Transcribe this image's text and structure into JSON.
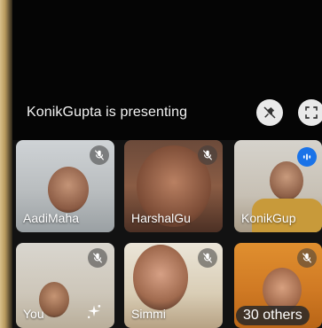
{
  "banner": {
    "presenting_text": "KonikGupta is presenting"
  },
  "controls": {
    "pin_icon": "unpin-icon",
    "fullscreen_icon": "fullscreen-icon"
  },
  "participants": [
    {
      "name": "AadiMaha",
      "muted": true
    },
    {
      "name": "HarshalGu",
      "muted": true
    },
    {
      "name": "KonikGup",
      "muted": false,
      "speaking": true
    },
    {
      "name": "You",
      "muted": true
    },
    {
      "name": "Simmi",
      "muted": true
    },
    {
      "name": "",
      "muted": true
    }
  ],
  "others_label": "30 others",
  "colors": {
    "speaking_blue": "#1a73e8",
    "background": "#121212"
  }
}
